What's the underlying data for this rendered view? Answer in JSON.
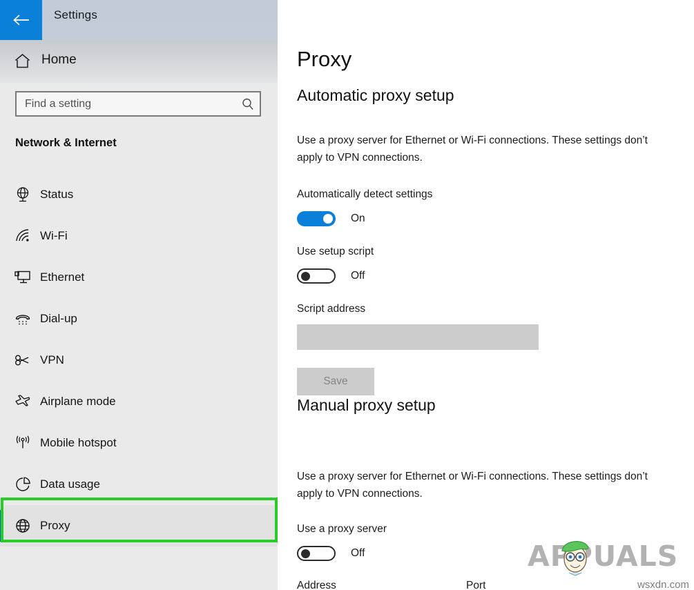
{
  "window": {
    "title": "Settings",
    "back_icon": "back-arrow-icon"
  },
  "sidebar": {
    "home": {
      "label": "Home",
      "icon": "home-icon"
    },
    "search": {
      "value": "",
      "placeholder": "Find a setting",
      "icon": "search-icon"
    },
    "category": "Network & Internet",
    "items": [
      {
        "label": "Status",
        "icon": "globe-monitor-icon",
        "selected": false
      },
      {
        "label": "Wi-Fi",
        "icon": "wifi-icon",
        "selected": false
      },
      {
        "label": "Ethernet",
        "icon": "ethernet-icon",
        "selected": false
      },
      {
        "label": "Dial-up",
        "icon": "dialup-phone-icon",
        "selected": false
      },
      {
        "label": "VPN",
        "icon": "vpn-key-icon",
        "selected": false
      },
      {
        "label": "Airplane mode",
        "icon": "airplane-icon",
        "selected": false
      },
      {
        "label": "Mobile hotspot",
        "icon": "hotspot-icon",
        "selected": false
      },
      {
        "label": "Data usage",
        "icon": "pie-chart-icon",
        "selected": false
      },
      {
        "label": "Proxy",
        "icon": "globe-icon",
        "selected": true
      }
    ]
  },
  "main": {
    "page_title": "Proxy",
    "automatic": {
      "heading": "Automatic proxy setup",
      "description": "Use a proxy server for Ethernet or Wi-Fi connections. These settings don’t apply to VPN connections.",
      "auto_detect_label": "Automatically detect settings",
      "auto_detect_state": "On",
      "setup_script_label": "Use setup script",
      "setup_script_state": "Off",
      "script_address_label": "Script address",
      "script_address_value": "",
      "save_label": "Save"
    },
    "manual": {
      "heading": "Manual proxy setup",
      "description": "Use a proxy server for Ethernet or Wi-Fi connections. These settings don’t apply to VPN connections.",
      "use_proxy_label": "Use a proxy server",
      "use_proxy_state": "Off",
      "address_label": "Address",
      "port_label": "Port"
    }
  },
  "annotation": {
    "target": "Proxy",
    "color": "#28cc28"
  },
  "watermark": {
    "brand": "APPUALS",
    "url": "wsxdn.com"
  },
  "colors": {
    "accent_blue": "#0a80d8",
    "selection_bar": "#0a6cb4",
    "sidebar_bg": "#eaeaea",
    "titlebar_bg": "#c3cdd9",
    "disabled_gray": "#cccccc",
    "annotation_green": "#28cc28"
  }
}
